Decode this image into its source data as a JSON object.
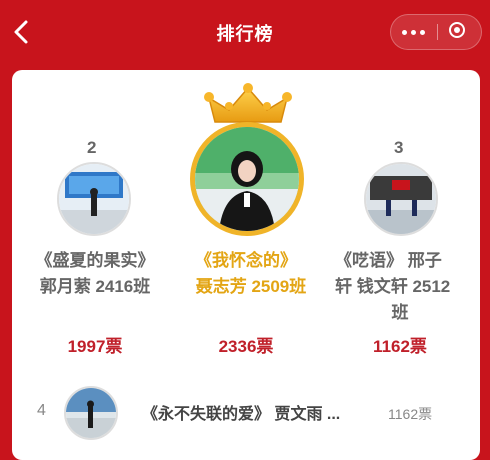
{
  "header": {
    "title": "排行榜",
    "back_icon": "chevron-left-icon",
    "more_icon": "more-dots-icon",
    "close_icon": "target-circle-icon"
  },
  "podium": [
    {
      "rank": "2",
      "title": "《盛夏的果实》",
      "author_line": "郭月萦 2416班",
      "votes": "1997票"
    },
    {
      "rank": "1",
      "title": "《我怀念的》",
      "author_line": "聂志芳 2509班",
      "votes": "2336票",
      "badge_icon": "crown-icon"
    },
    {
      "rank": "3",
      "title": "《呓语》 邢子",
      "author_line": "轩 钱文轩 2512",
      "author_line2": "班",
      "votes": "1162票"
    }
  ],
  "list": [
    {
      "rank": "4",
      "title": "《永不失联的爱》 贾文雨 ...",
      "votes": "1162票"
    }
  ],
  "colors": {
    "accent": "#c8141c",
    "gold": "#e3a514",
    "vote": "#c0202a"
  }
}
